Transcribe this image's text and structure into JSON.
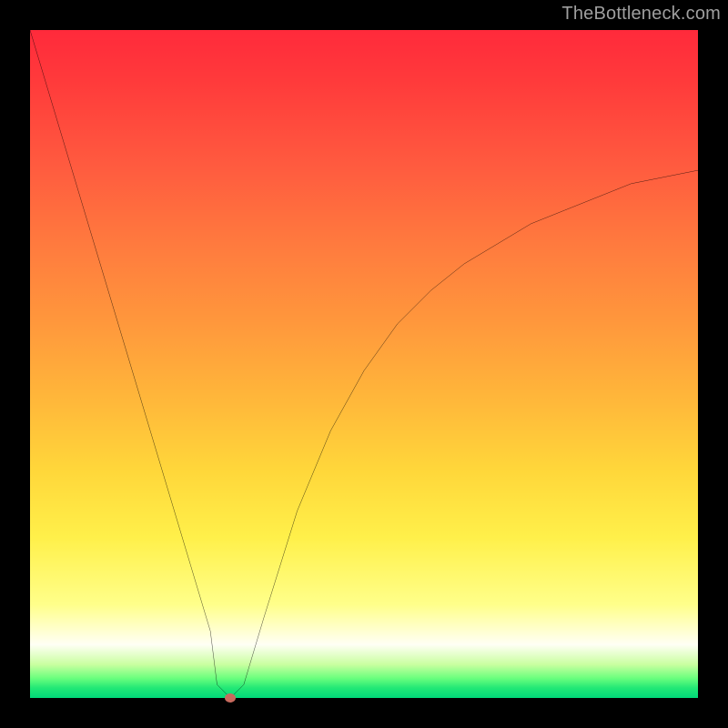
{
  "watermark": {
    "text": "TheBottleneck.com"
  },
  "chart_data": {
    "type": "line",
    "title": "",
    "xlabel": "",
    "ylabel": "",
    "xlim": [
      0,
      100
    ],
    "ylim": [
      0,
      100
    ],
    "background_gradient": [
      "#ff2a3b",
      "#ff7a3e",
      "#ffd73a",
      "#ffff8a",
      "#00d878"
    ],
    "series": [
      {
        "name": "bottleneck-curve",
        "x": [
          0,
          3,
          6,
          9,
          12,
          15,
          18,
          21,
          24,
          27,
          28,
          30,
          32,
          35,
          40,
          45,
          50,
          55,
          60,
          65,
          70,
          75,
          80,
          85,
          90,
          95,
          100
        ],
        "values": [
          100,
          90,
          80,
          70,
          60,
          50,
          40,
          30,
          20,
          10,
          2,
          0,
          2,
          12,
          28,
          40,
          49,
          56,
          61,
          65,
          68,
          71,
          73,
          75,
          77,
          78,
          79
        ]
      }
    ],
    "marker": {
      "name": "optimal-point",
      "x": 30,
      "y": 0,
      "color": "#c86a5e"
    }
  }
}
